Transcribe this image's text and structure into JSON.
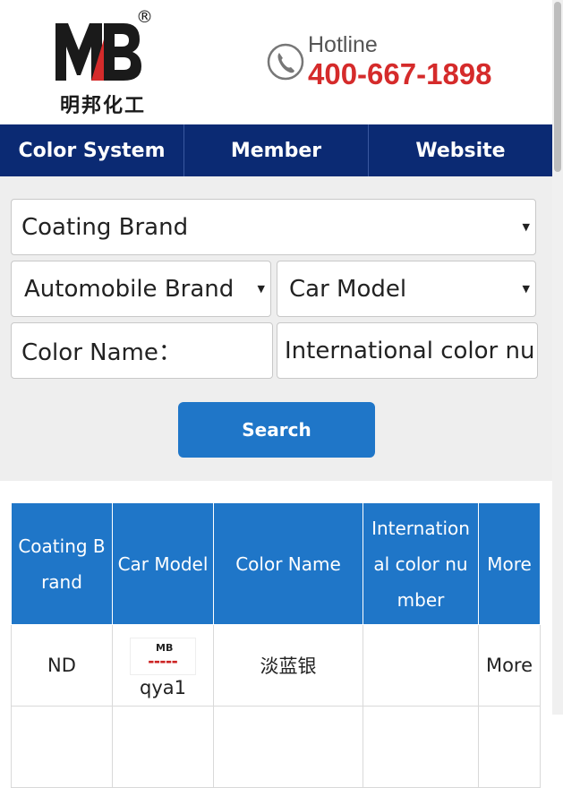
{
  "brand": {
    "logo_mark": "MB",
    "logo_text": "明邦化工",
    "registered": "®"
  },
  "hotline": {
    "label": "Hotline",
    "number": "400-667-1898"
  },
  "nav": {
    "items": [
      "Color System",
      "Member",
      "Website"
    ]
  },
  "search": {
    "coating_brand": "Coating Brand",
    "automobile_brand": "Automobile Brand",
    "car_model": "Car Model",
    "color_name_label": "Color Name：",
    "intl_color_placeholder": "International color nu",
    "button": "Search"
  },
  "table": {
    "headers": [
      "Coating Brand",
      "Car Model",
      "Color Name",
      "International color number",
      "More"
    ],
    "rows": [
      {
        "brand": "ND",
        "model": "qya1",
        "color_name": "淡蓝银",
        "intl": "",
        "more": "More"
      }
    ]
  },
  "colors": {
    "nav_bg": "#0b2a73",
    "accent": "#1f76c8",
    "hotline": "#d52b2b",
    "panel_bg": "#eeeeee"
  }
}
